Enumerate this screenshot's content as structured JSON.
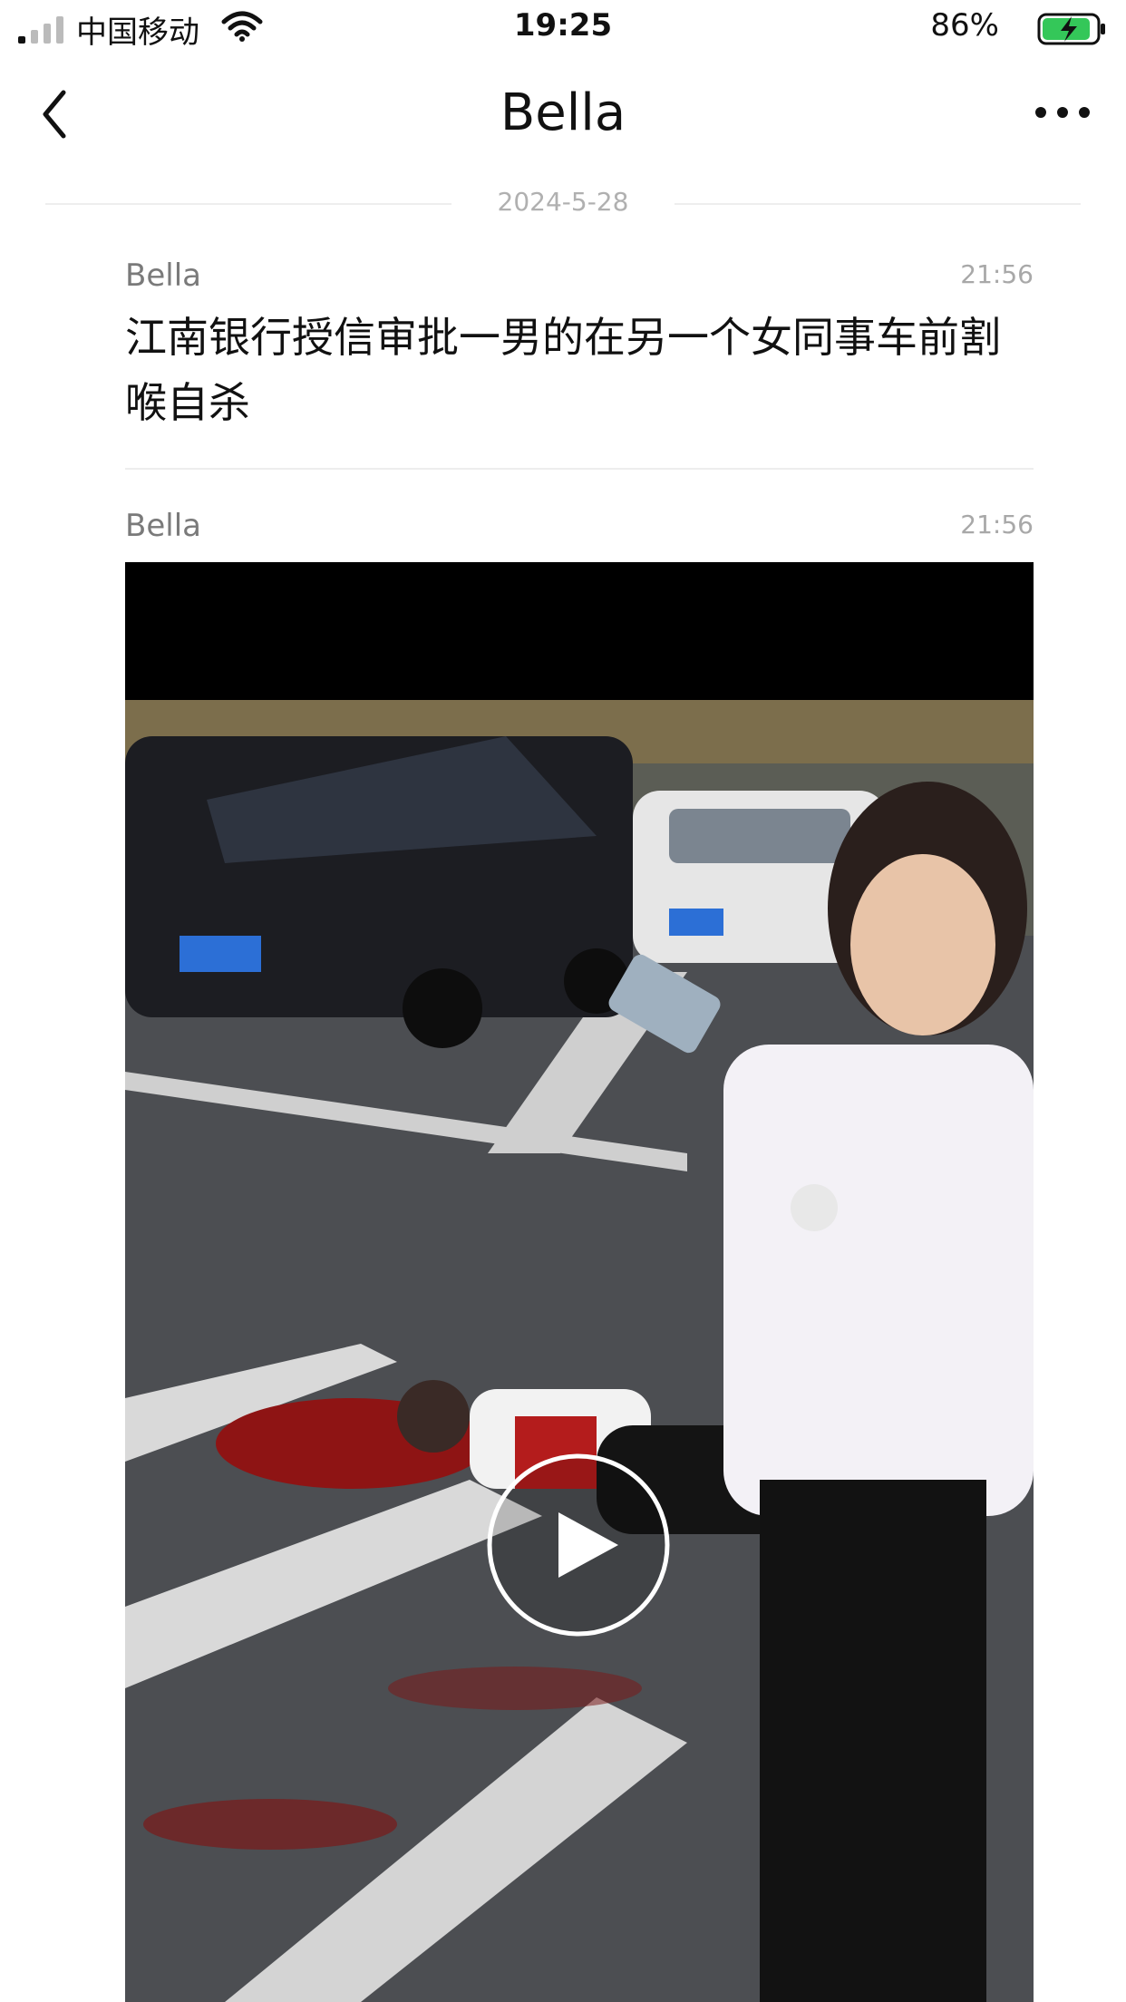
{
  "status_bar": {
    "carrier": "中国移动",
    "time": "19:25",
    "battery_percent": "86%",
    "icons": [
      "signal-icon",
      "wifi-icon",
      "battery-charging-icon"
    ]
  },
  "nav": {
    "title": "Bella",
    "back_icon": "chevron-left-icon",
    "more_icon": "more-dots-icon"
  },
  "date_separator": "2024-5-28",
  "messages": [
    {
      "sender": "Bella",
      "time": "21:56",
      "text": "江南银行授信审批一男的在另一个女同事车前割喉自杀"
    },
    {
      "sender": "Bella",
      "time": "21:56",
      "type": "video",
      "play_icon": "play-icon"
    }
  ],
  "colors": {
    "background": "#ffffff",
    "text_primary": "#111111",
    "text_secondary": "#7a7a7a",
    "battery_green": "#34c759"
  }
}
